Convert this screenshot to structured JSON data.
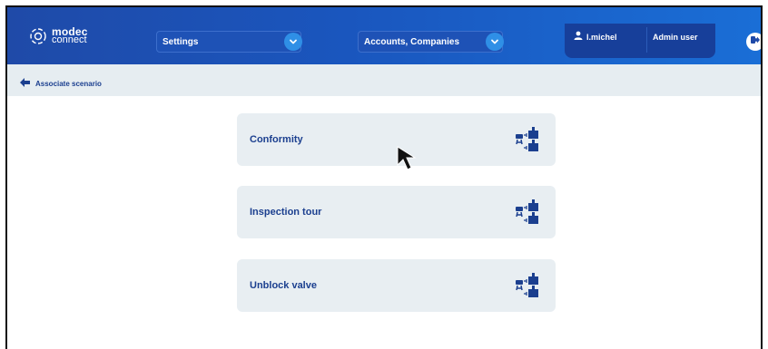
{
  "brand": {
    "line1": "modec",
    "line2": "connect"
  },
  "header": {
    "module_select": {
      "value": "Settings"
    },
    "section_select": {
      "value": "Accounts, Companies"
    },
    "user": {
      "name": "l.michel",
      "role": "Admin user"
    }
  },
  "subheader": {
    "back_label": "Associate scenario"
  },
  "scenarios": [
    {
      "label": "Conformity"
    },
    {
      "label": "Inspection tour"
    },
    {
      "label": "Unblock valve"
    }
  ],
  "colors": {
    "header": "#1f4aa8",
    "accent": "#2f8fe6",
    "text_primary": "#1b3f8f",
    "card_bg": "#e8eef2"
  },
  "icons": [
    "logo-icon",
    "chevron-down-icon",
    "user-icon",
    "logout-icon",
    "arrow-left-icon",
    "associate-scenario-icon",
    "mouse-cursor-icon"
  ]
}
